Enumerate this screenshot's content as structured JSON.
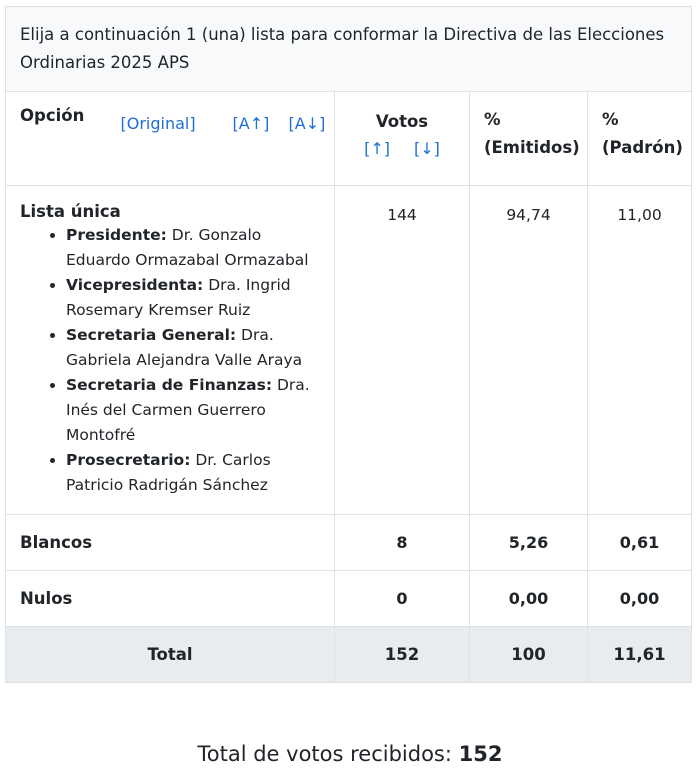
{
  "title": "Elija a continuación 1 (una) lista para conformar la Directiva de las Elecciones Ordinarias 2025 APS",
  "headers": {
    "option": "Opción",
    "sort_original": "[Original]",
    "sort_alpha_up": "[A↑]",
    "sort_alpha_down": "[A↓]",
    "votes": "Votos",
    "votes_up": "[↑]",
    "votes_down": "[↓]",
    "pct_emitted_1": "%",
    "pct_emitted_2": "(Emitidos)",
    "pct_roll_1": "%",
    "pct_roll_2": "(Padrón)"
  },
  "list": {
    "name": "Lista única",
    "members": [
      {
        "role": "Presidente:",
        "name": "Dr. Gonzalo Eduardo Ormazabal Ormazabal"
      },
      {
        "role": "Vicepresidenta:",
        "name": "Dra. Ingrid Rosemary Kremser Ruiz"
      },
      {
        "role": "Secretaria General:",
        "name": "Dra. Gabriela Alejandra Valle Araya"
      },
      {
        "role": "Secretaria de Finanzas:",
        "name": "Dra. Inés del Carmen Guerrero Montofré"
      },
      {
        "role": "Prosecretario:",
        "name": "Dr. Carlos Patricio Radrigán Sánchez"
      }
    ],
    "votes": "144",
    "pct_emitted": "94,74",
    "pct_roll": "11,00"
  },
  "blank": {
    "label": "Blancos",
    "votes": "8",
    "pct_emitted": "5,26",
    "pct_roll": "0,61"
  },
  "null": {
    "label": "Nulos",
    "votes": "0",
    "pct_emitted": "0,00",
    "pct_roll": "0,00"
  },
  "total": {
    "label": "Total",
    "votes": "152",
    "pct_emitted": "100",
    "pct_roll": "11,61"
  },
  "footer": {
    "label": "Total de votos recibidos:",
    "value": "152"
  }
}
